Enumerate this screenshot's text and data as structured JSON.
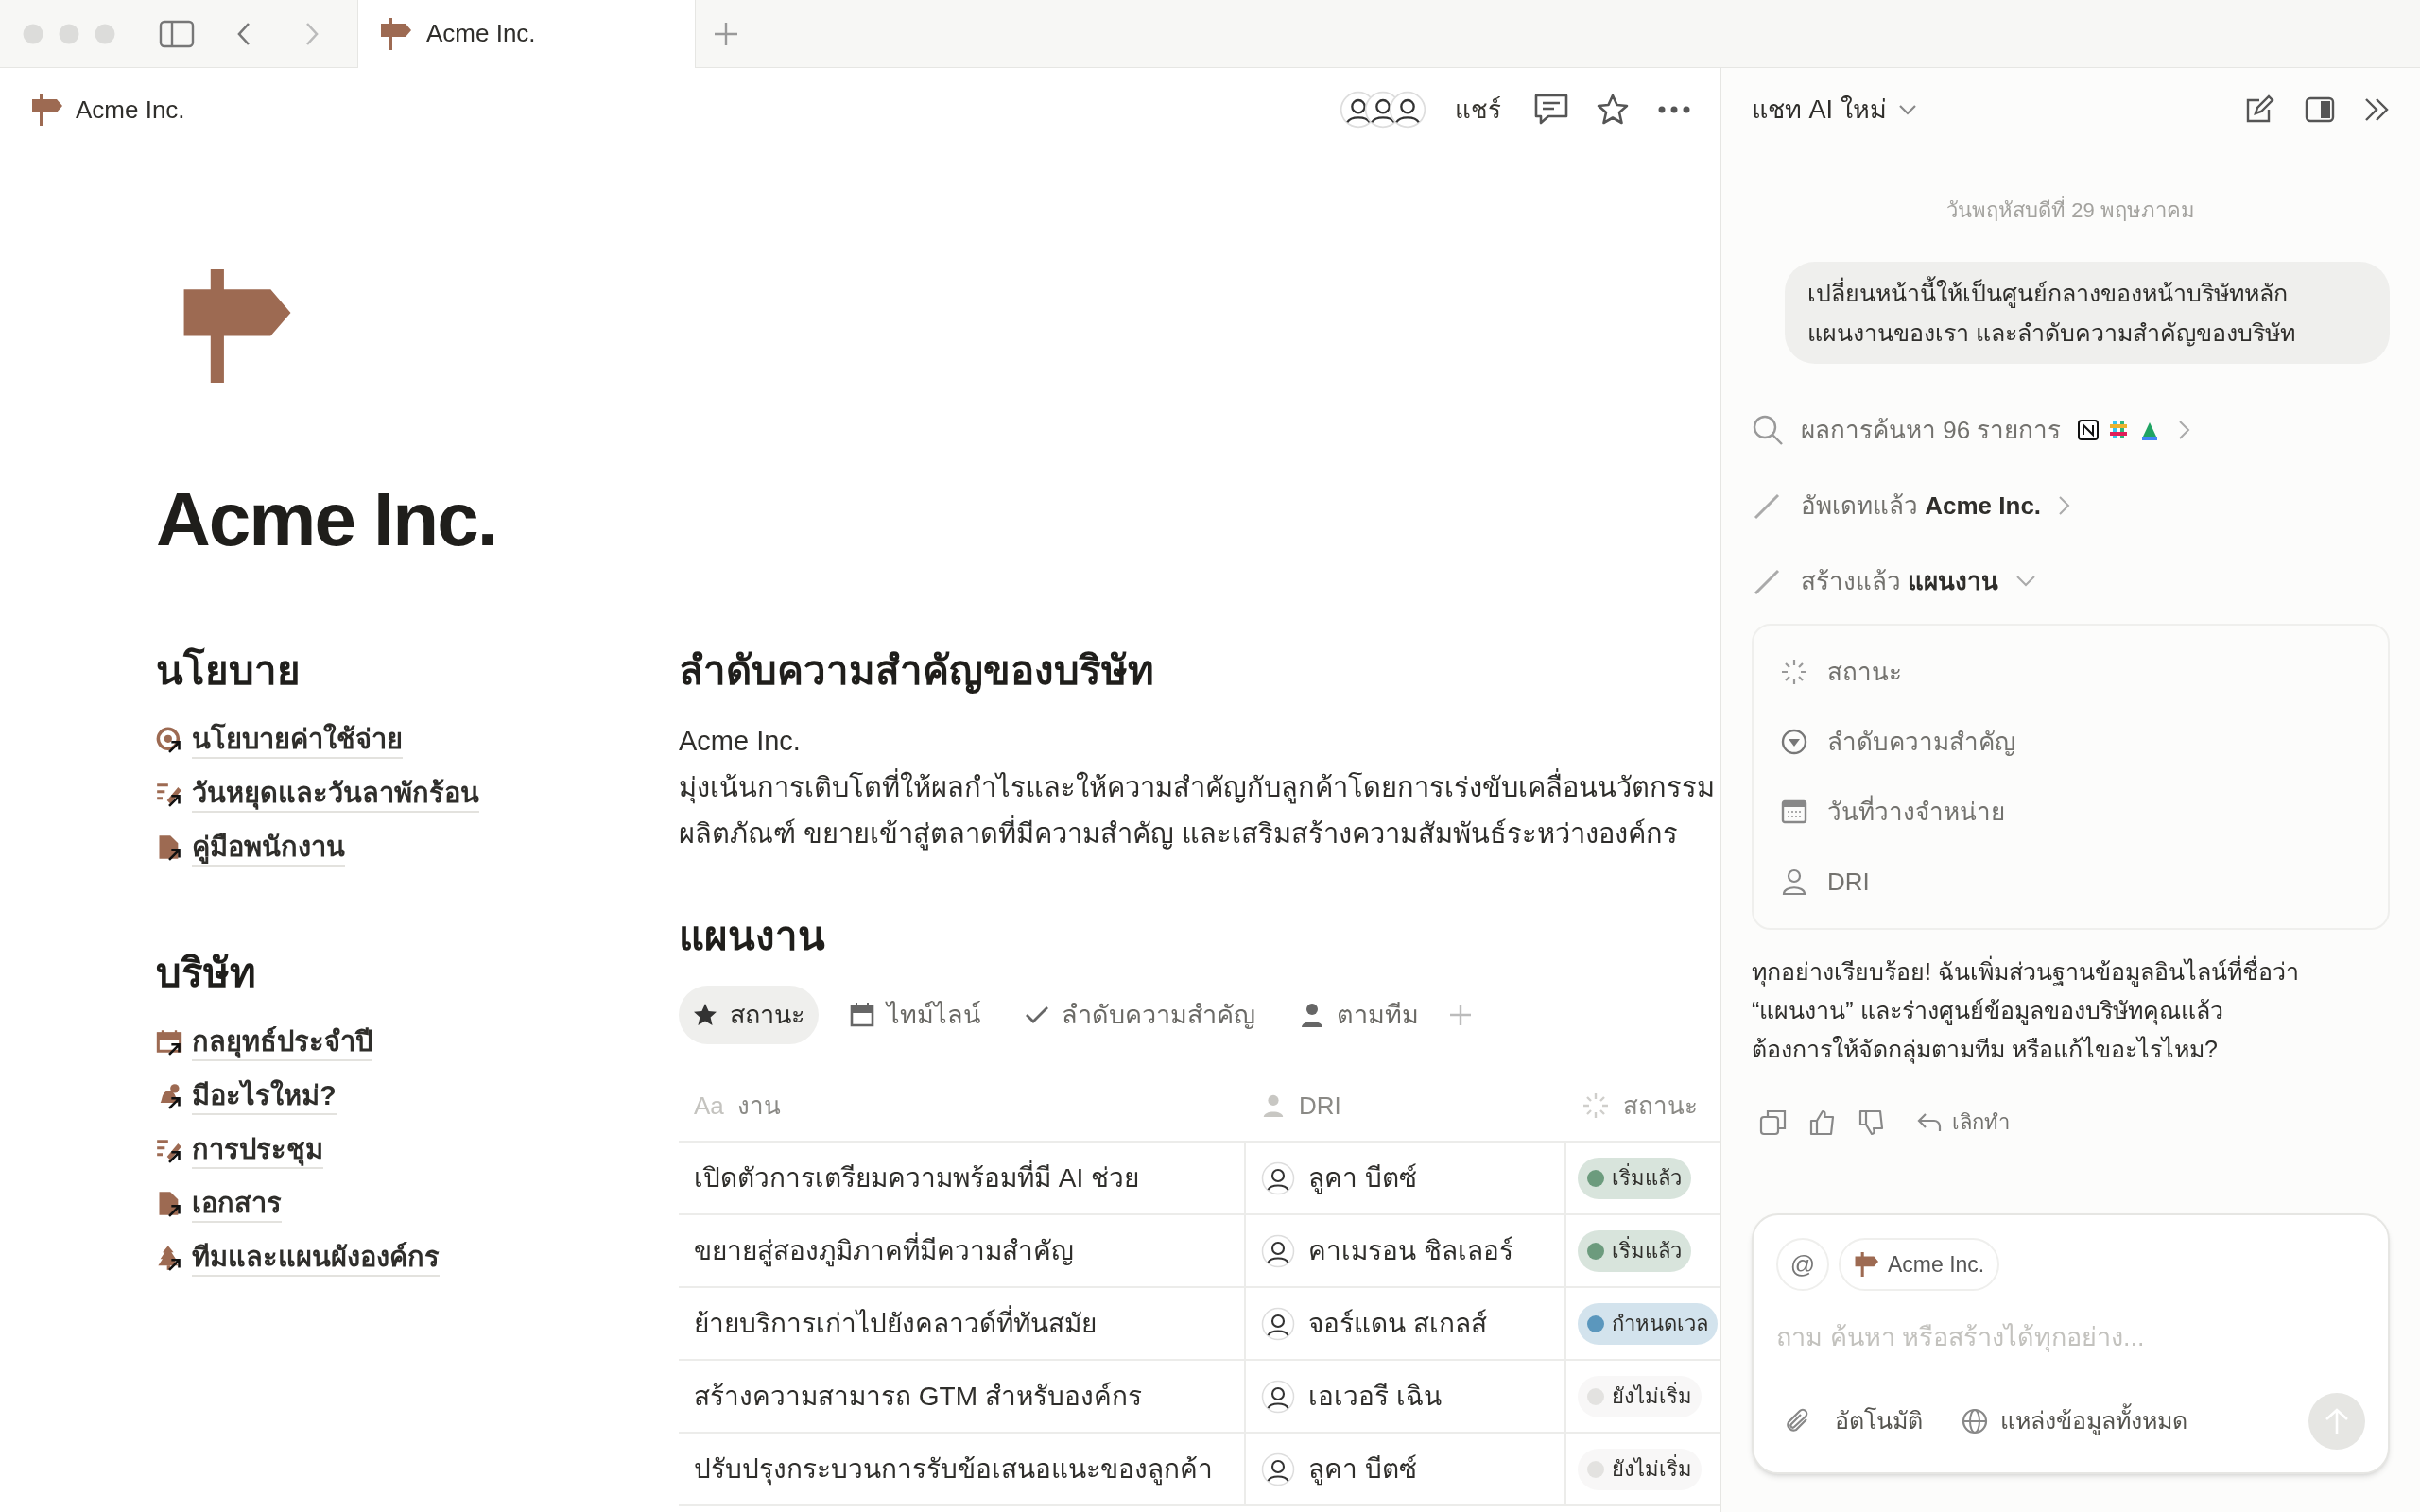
{
  "browser": {
    "tab": {
      "title": "Acme Inc."
    }
  },
  "page": {
    "breadcrumb": "Acme Inc.",
    "share": "แชร์",
    "title": "Acme Inc."
  },
  "sections": [
    {
      "heading": "นโยบาย",
      "links": [
        {
          "label": "นโยบายค่าใช้จ่าย",
          "kind": "target"
        },
        {
          "label": "วันหยุดและวันลาพักร้อน",
          "kind": "pen"
        },
        {
          "label": "คู่มือพนักงาน",
          "kind": "doc"
        }
      ]
    },
    {
      "heading": "บริษัท",
      "links": [
        {
          "label": "กลยุทธ์ประจำปี",
          "kind": "calendar"
        },
        {
          "label": "มีอะไรใหม่?",
          "kind": "bell"
        },
        {
          "label": "การประชุม",
          "kind": "pen"
        },
        {
          "label": "เอกสาร",
          "kind": "doc"
        },
        {
          "label": "ทีมและแผนผังองค์กร",
          "kind": "tree"
        }
      ]
    }
  ],
  "priorities": {
    "heading": "ลำดับความสำคัญของบริษัท",
    "lines": [
      "Acme Inc.",
      "มุ่งเน้นการเติบโตที่ให้ผลกำไรและให้ความสำคัญกับลูกค้าโดยการเร่งขับเคลื่อนนวัตกรรม",
      "ผลิตภัณฑ์ ขยายเข้าสู่ตลาดที่มีความสำคัญ และเสริมสร้างความสัมพันธ์ระหว่างองค์กร"
    ]
  },
  "roadmap": {
    "heading": "แผนงาน",
    "views": [
      {
        "label": "สถานะ",
        "kind": "star",
        "selected": true
      },
      {
        "label": "ไทม์ไลน์",
        "kind": "calendar",
        "selected": false
      },
      {
        "label": "ลำดับความสำคัญ",
        "kind": "check",
        "selected": false
      },
      {
        "label": "ตามทีม",
        "kind": "person",
        "selected": false
      }
    ],
    "columns": [
      {
        "label": "งาน",
        "kind": "title",
        "type_marker": "Aa"
      },
      {
        "label": "DRI",
        "kind": "person"
      },
      {
        "label": "สถานะ",
        "kind": "status"
      }
    ],
    "rows": [
      {
        "task": "เปิดตัวการเตรียมความพร้อมที่มี AI ช่วย",
        "dri": "ลูคา บีตซ์",
        "status": {
          "label": "เริ่มแล้ว",
          "color": "#6c9b7d"
        }
      },
      {
        "task": "ขยายสู่สองภูมิภาคที่มีความสำคัญ",
        "dri": "คาเมรอน ชิลเลอร์",
        "status": {
          "label": "เริ่มแล้ว",
          "color": "#6c9b7d"
        }
      },
      {
        "task": "ย้ายบริการเก่าไปยังคลาวด์ที่ทันสมัย",
        "dri": "จอร์แดน สเกลส์",
        "status": {
          "label": "กำหนดเวล",
          "color": "#5b97bd"
        }
      },
      {
        "task": "สร้างความสามารถ GTM สำหรับองค์กร",
        "dri": "เอเวอรี เฉิน",
        "status": {
          "label": "ยังไม่เริ่ม",
          "color": "#e3e2e0"
        }
      },
      {
        "task": "ปรับปรุงกระบวนการรับข้อเสนอแนะของลูกค้า",
        "dri": "ลูคา บีตซ์",
        "status": {
          "label": "ยังไม่เริ่ม",
          "color": "#e3e2e0"
        }
      }
    ]
  },
  "chat": {
    "title": "แชท AI ใหม่",
    "date": "วันพฤหัสบดีที่ 29 พฤษภาคม",
    "user_message": [
      "เปลี่ยนหน้านี้ให้เป็นศูนย์กลางของหน้าบริษัทหลัก",
      "แผนงานของเรา และลำดับความสำคัญของบริษัท"
    ],
    "steps": [
      {
        "kind": "search",
        "text": "ผลการค้นหา 96 รายการ",
        "expanded": false
      },
      {
        "kind": "edit",
        "text": "อัพเดทแล้ว **Acme Inc.**",
        "expanded": false
      },
      {
        "kind": "edit",
        "text": "สร้างแล้ว **แผนงาน**",
        "expanded": true
      }
    ],
    "properties": [
      {
        "label": "สถานะ",
        "kind": "status"
      },
      {
        "label": "ลำดับความสำคัญ",
        "kind": "select"
      },
      {
        "label": "วันที่วางจำหน่าย",
        "kind": "date"
      },
      {
        "label": "DRI",
        "kind": "person"
      }
    ],
    "reply": [
      "ทุกอย่างเรียบร้อย! ฉันเพิ่มส่วนฐานข้อมูลอินไลน์ที่ชื่อว่า",
      "“แผนงาน” และร่างศูนย์ข้อมูลของบริษัทคุณแล้ว",
      "ต้องการให้จัดกลุ่มตามทีม หรือแก้ไขอะไรไหม?"
    ],
    "undo": "เลิกทำ",
    "composer": {
      "mention": "@",
      "context": "Acme Inc.",
      "placeholder": "ถาม ค้นหา หรือสร้างได้ทุกอย่าง...",
      "mode": "อัตโนมัติ",
      "sources": "แหล่งข้อมูลทั้งหมด"
    }
  }
}
